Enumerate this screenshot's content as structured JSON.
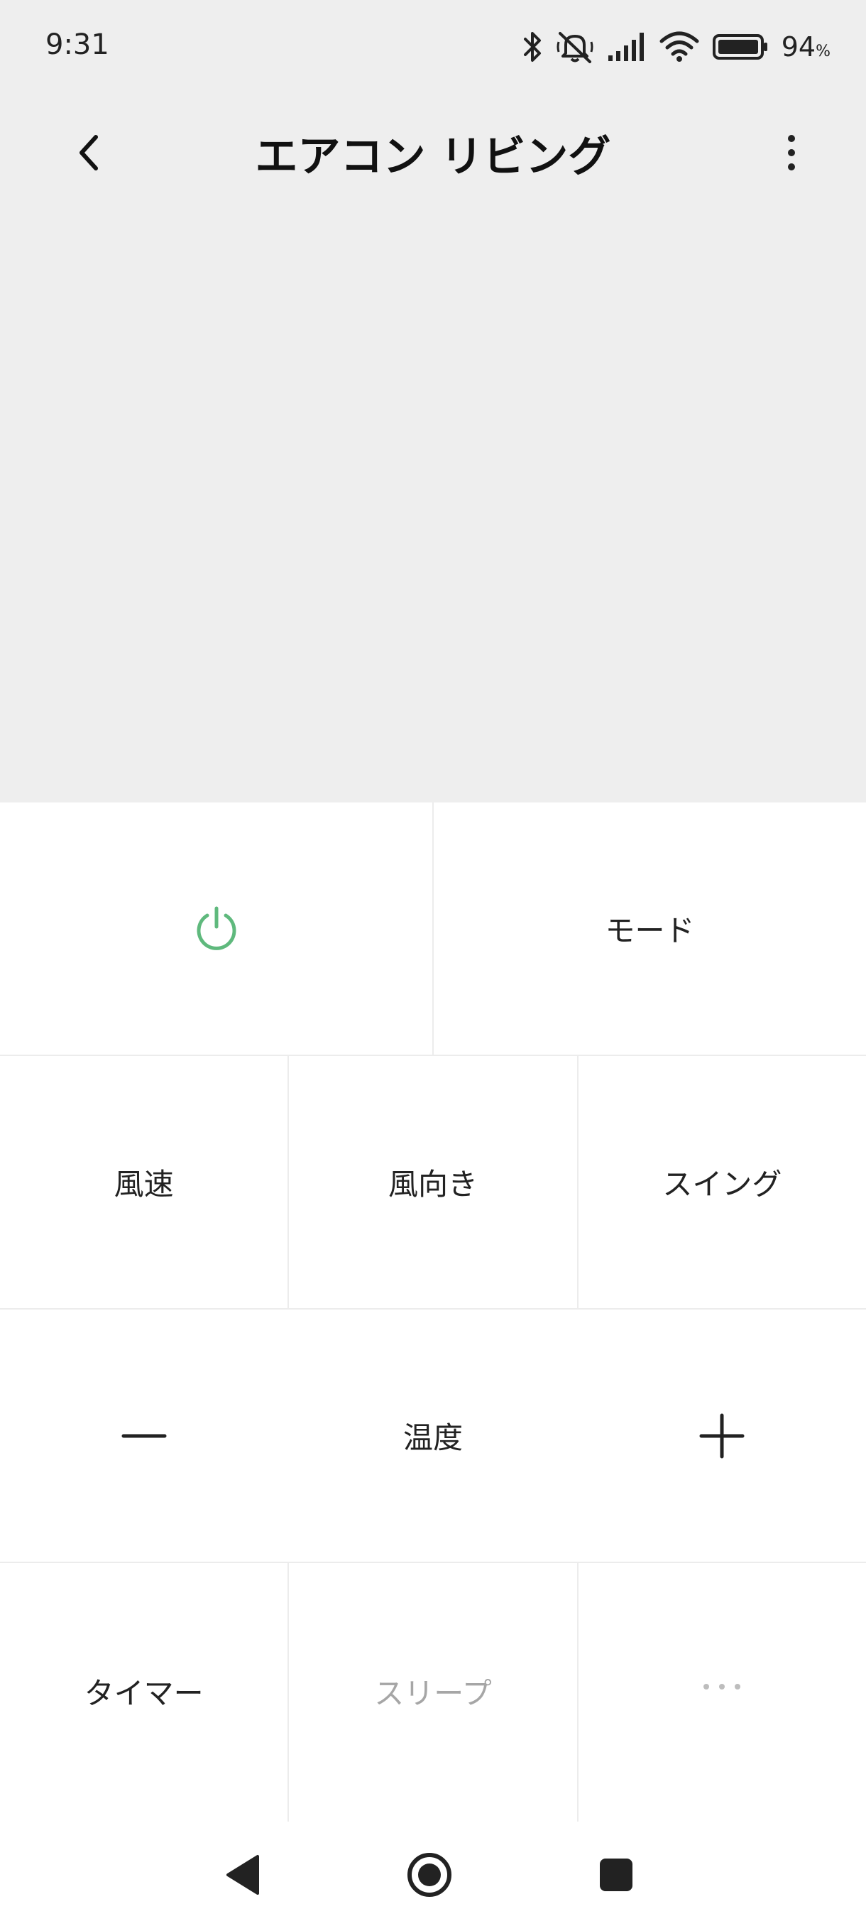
{
  "status_bar": {
    "time": "9:31",
    "icons": [
      "bluetooth-icon",
      "mute-icon",
      "signal-icon",
      "wifi-icon",
      "battery-icon"
    ],
    "battery_value": "94",
    "battery_unit": "%"
  },
  "header": {
    "title": "エアコン リビング",
    "back_icon": "chevron-left-icon",
    "more_icon": "more-vertical-icon"
  },
  "controls": {
    "power_icon": "power-icon",
    "power_color": "#5fb97d",
    "mode_label": "モード",
    "fan_speed_label": "風速",
    "wind_direction_label": "風向き",
    "swing_label": "スイング",
    "temp_down_icon": "minus-icon",
    "temperature_label": "温度",
    "temp_up_icon": "plus-icon",
    "timer_label": "タイマー",
    "sleep_label": "スリープ",
    "more_icon": "ellipsis-icon"
  },
  "nav_bar": {
    "icons": [
      "nav-back-icon",
      "nav-home-icon",
      "nav-recents-icon"
    ]
  }
}
